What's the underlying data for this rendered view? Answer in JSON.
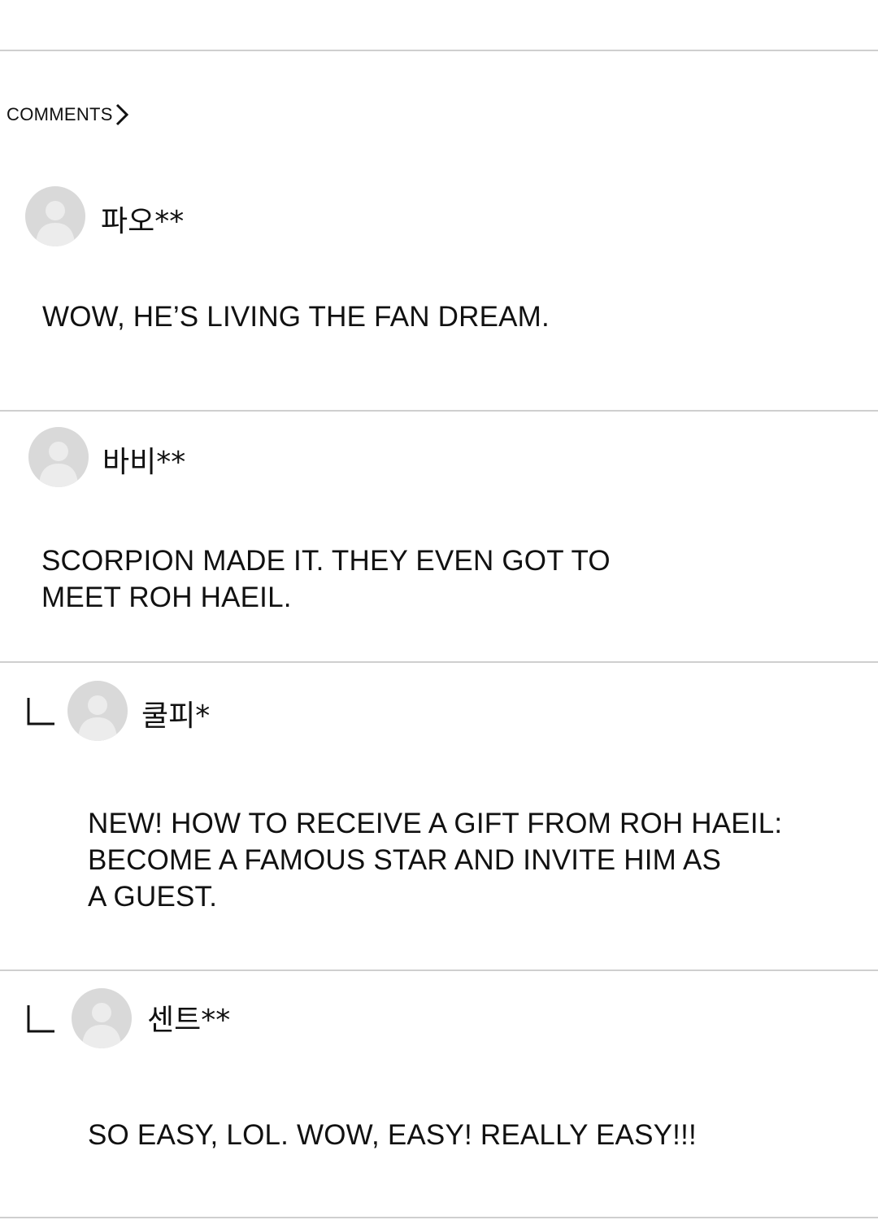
{
  "header": {
    "label": "COMMENTS"
  },
  "comments": [
    {
      "username": "파오**",
      "text": "WOW, HE’S LIVING THE FAN DREAM.",
      "is_reply": false
    },
    {
      "username": "바비**",
      "text": "SCORPION MADE IT. THEY EVEN GOT TO\nMEET ROH HAEIL.",
      "is_reply": false
    },
    {
      "username": "쿨피*",
      "text": "NEW! HOW TO RECEIVE A GIFT FROM ROH HAEIL:\nBECOME A FAMOUS STAR AND INVITE HIM AS\nA GUEST.",
      "is_reply": true
    },
    {
      "username": "센트**",
      "text": "SO EASY, LOL. WOW, EASY! REALLY EASY!!!",
      "is_reply": true
    }
  ],
  "icons": {
    "header_chevron": "chevron-right-icon",
    "reply": "reply-corner-icon",
    "avatar": "default-user-avatar"
  },
  "colors": {
    "background": "#ffffff",
    "text": "#111111",
    "divider": "#cfcfcf",
    "avatar_bg": "#d9d9d9",
    "avatar_figure": "#f0f0f0"
  }
}
